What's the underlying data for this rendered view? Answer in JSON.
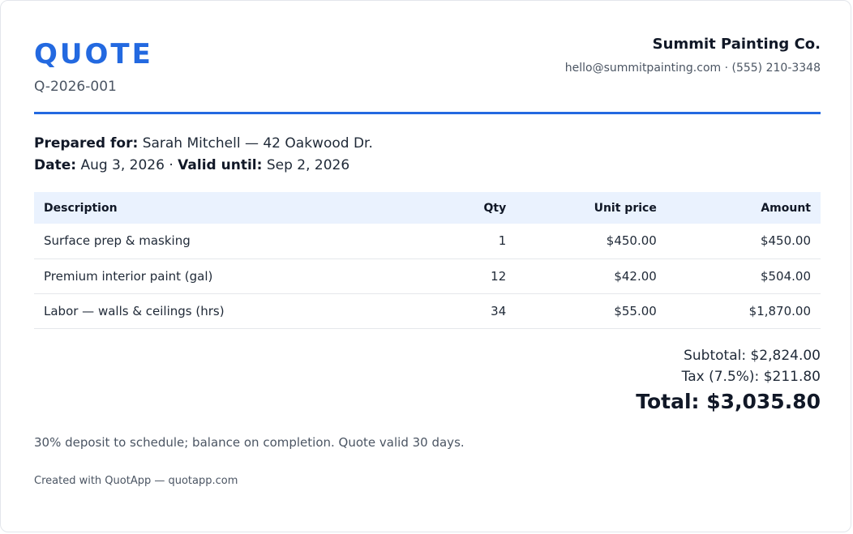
{
  "header": {
    "title": "QUOTE",
    "number": "Q-2026-001"
  },
  "company": {
    "name": "Summit Painting Co.",
    "contact": "hello@summitpainting.com · (555) 210-3348"
  },
  "meta": {
    "prepared_for_label": "Prepared for:",
    "prepared_for_value": "Sarah Mitchell — 42 Oakwood Dr.",
    "date_label": "Date:",
    "date_value": "Aug 3, 2026",
    "separator": "·",
    "valid_label": "Valid until:",
    "valid_value": "Sep 2, 2026"
  },
  "table": {
    "headers": [
      "Description",
      "Qty",
      "Unit price",
      "Amount"
    ],
    "rows": [
      [
        "Surface prep & masking",
        "1",
        "$450.00",
        "$450.00"
      ],
      [
        "Premium interior paint (gal)",
        "12",
        "$42.00",
        "$504.00"
      ],
      [
        "Labor — walls & ceilings (hrs)",
        "34",
        "$55.00",
        "$1,870.00"
      ]
    ]
  },
  "totals": {
    "subtotal": "Subtotal: $2,824.00",
    "tax": "Tax (7.5%): $211.80",
    "total": "Total: $3,035.80"
  },
  "terms": "30% deposit to schedule; balance on completion. Quote valid 30 days.",
  "footer": "Created with QuotApp — quotapp.com",
  "colors": {
    "accent": "#2369e0",
    "header_row": "#eaf2fe"
  }
}
